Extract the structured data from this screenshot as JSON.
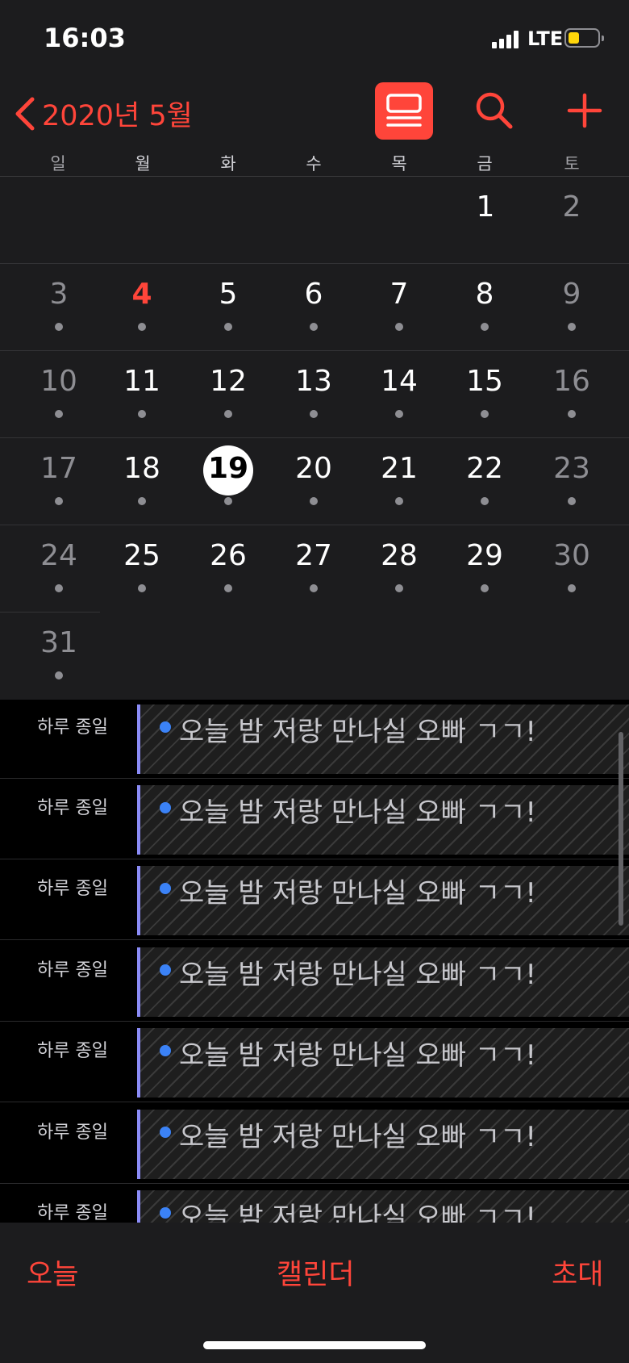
{
  "status": {
    "time": "16:03",
    "network": "LTE",
    "battery_level": 0.3
  },
  "header": {
    "back_label": "2020년 5월"
  },
  "colors": {
    "accent": "#ff453a",
    "event_bar": "#8b8cf7",
    "event_dot": "#3b82f6",
    "battery": "#ffd60a"
  },
  "weekdays": [
    "일",
    "월",
    "화",
    "수",
    "목",
    "금",
    "토"
  ],
  "calendar": {
    "month_days": [
      "1",
      "2",
      "3",
      "4",
      "5",
      "6",
      "7",
      "8",
      "9",
      "10",
      "11",
      "12",
      "13",
      "14",
      "15",
      "16",
      "17",
      "18",
      "19",
      "20",
      "21",
      "22",
      "23",
      "24",
      "25",
      "26",
      "27",
      "28",
      "29",
      "30",
      "31"
    ],
    "today": "19",
    "holiday": "4"
  },
  "events": [
    {
      "time_label": "하루 종일",
      "title": "오늘 밤 저랑 만나실 오빠 ㄱㄱ!"
    },
    {
      "time_label": "하루 종일",
      "title": "오늘 밤 저랑 만나실 오빠 ㄱㄱ!"
    },
    {
      "time_label": "하루 종일",
      "title": "오늘 밤 저랑 만나실 오빠 ㄱㄱ!"
    },
    {
      "time_label": "하루 종일",
      "title": "오늘 밤 저랑 만나실 오빠 ㄱㄱ!"
    },
    {
      "time_label": "하루 종일",
      "title": "오늘 밤 저랑 만나실 오빠 ㄱㄱ!"
    },
    {
      "time_label": "하루 종일",
      "title": "오늘 밤 저랑 만나실 오빠 ㄱㄱ!"
    },
    {
      "time_label": "하루 종일",
      "title": "오늘 밤 저랑 만나실 오빠 ㄱㄱ!"
    }
  ],
  "tabbar": {
    "today": "오늘",
    "calendars": "캘린더",
    "inbox": "초대"
  }
}
